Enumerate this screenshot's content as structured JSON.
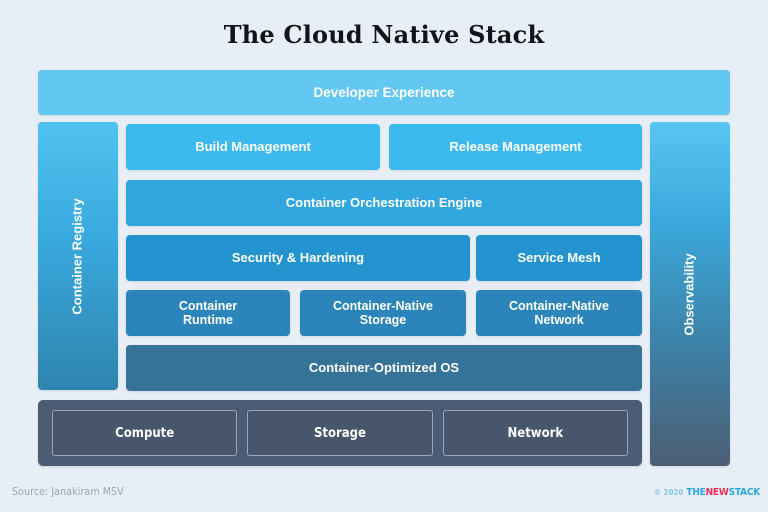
{
  "title": "The Cloud Native Stack",
  "colors": {
    "background": "#e8eef5",
    "developer_experience": "#62c8f2",
    "tier_build": "#3cb9ef",
    "tier_orchestration": "#32a6df",
    "tier_security": "#2494d0",
    "tier_runtime": "#2b84ba",
    "tier_os": "#357399",
    "infrastructure": "#4c5c74",
    "brand_blue": "#2aa7e0",
    "brand_pink": "#ee2b5b"
  },
  "diagram": {
    "developer_experience": "Developer Experience",
    "left_column": "Container Registry",
    "right_column": "Observability",
    "tiers": {
      "build": "Build Management",
      "release": "Release Management",
      "orchestration": "Container Orchestration Engine",
      "security": "Security & Hardening",
      "service_mesh": "Service Mesh",
      "container_runtime": "Container\nRuntime",
      "container_native_storage": "Container-Native\nStorage",
      "container_native_network": "Container-Native\nNetwork",
      "container_optimized_os": "Container-Optimized OS"
    },
    "infrastructure": {
      "compute": "Compute",
      "storage": "Storage",
      "network": "Network"
    }
  },
  "footer": {
    "source": "Source: Janakiram MSV",
    "copyright": "© 2020",
    "brand_the": "THE",
    "brand_new": "NEW",
    "brand_stack": "STACK"
  }
}
